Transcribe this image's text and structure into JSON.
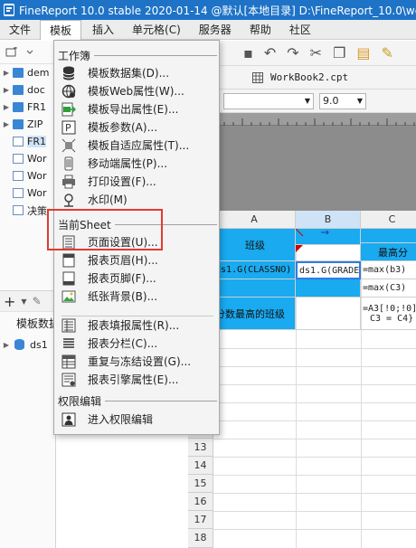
{
  "window": {
    "title": "FineReport 10.0 stable 2020-01-14 @默认[本地目录]   D:\\FineReport_10.0\\we"
  },
  "menubar": {
    "items": [
      "文件",
      "模板",
      "插入",
      "单元格(C)",
      "服务器",
      "帮助",
      "社区"
    ],
    "active_index": 1
  },
  "left_panel": {
    "tree": [
      {
        "label": "dem",
        "type": "folder"
      },
      {
        "label": "doc",
        "type": "folder"
      },
      {
        "label": "FR1",
        "type": "folder"
      },
      {
        "label": "ZIP",
        "type": "folder"
      },
      {
        "label": "FR1",
        "type": "file",
        "selected": true
      },
      {
        "label": "Wor",
        "type": "file"
      },
      {
        "label": "Wor",
        "type": "file"
      },
      {
        "label": "Wor",
        "type": "file"
      },
      {
        "label": "决策",
        "type": "file"
      }
    ],
    "datasource_header": "模板数据",
    "datasource_item": "ds1"
  },
  "toolbar": {
    "tab_label": "WorkBook2.cpt",
    "font_size": "9.0"
  },
  "grid": {
    "column_headers": [
      "A",
      "B",
      "C"
    ],
    "row_numbers": [
      "13",
      "14",
      "15",
      "16",
      "17",
      "18"
    ],
    "cells": {
      "a1": "班级",
      "c1": "最高分",
      "a2": "ds1.G(CLASSNO)",
      "b2": "ds1.G(GRADE",
      "c2": "=max(b3)",
      "c3": "=max(C3)",
      "a4": "分数最高的班级",
      "c4_line1": "=A3[!0;!0]",
      "c4_line2": "C3 = C4}"
    }
  },
  "menu": {
    "section_workbook": "工作簿",
    "section_sheet": "当前Sheet",
    "section_permission": "权限编辑",
    "workbook_items": [
      {
        "label": "模板数据集(D)...",
        "icon": "database-icon"
      },
      {
        "label": "模板Web属性(W)...",
        "icon": "web-gear-icon"
      },
      {
        "label": "模板导出属性(E)...",
        "icon": "export-icon"
      },
      {
        "label": "模板参数(A)...",
        "icon": "parameter-icon"
      },
      {
        "label": "模板自适应属性(T)...",
        "icon": "adaptive-icon"
      },
      {
        "label": "移动端属性(P)...",
        "icon": "mobile-icon"
      },
      {
        "label": "打印设置(F)...",
        "icon": "printer-icon"
      },
      {
        "label": "水印(M)",
        "icon": "watermark-icon"
      }
    ],
    "sheet_items": [
      {
        "label": "页面设置(U)...",
        "icon": "page-setup-icon"
      },
      {
        "label": "报表页眉(H)...",
        "icon": "header-icon"
      },
      {
        "label": "报表页脚(F)...",
        "icon": "footer-icon"
      },
      {
        "label": "纸张背景(B)...",
        "icon": "background-image-icon"
      }
    ],
    "sheet_items_2": [
      {
        "label": "报表填报属性(R)...",
        "icon": "fill-attributes-icon"
      },
      {
        "label": "报表分栏(C)...",
        "icon": "columns-icon"
      },
      {
        "label": "重复与冻结设置(G)...",
        "icon": "freeze-icon"
      },
      {
        "label": "报表引擎属性(E)...",
        "icon": "engine-icon"
      }
    ],
    "permission_items": [
      {
        "label": "进入权限编辑",
        "icon": "permission-icon"
      }
    ]
  }
}
